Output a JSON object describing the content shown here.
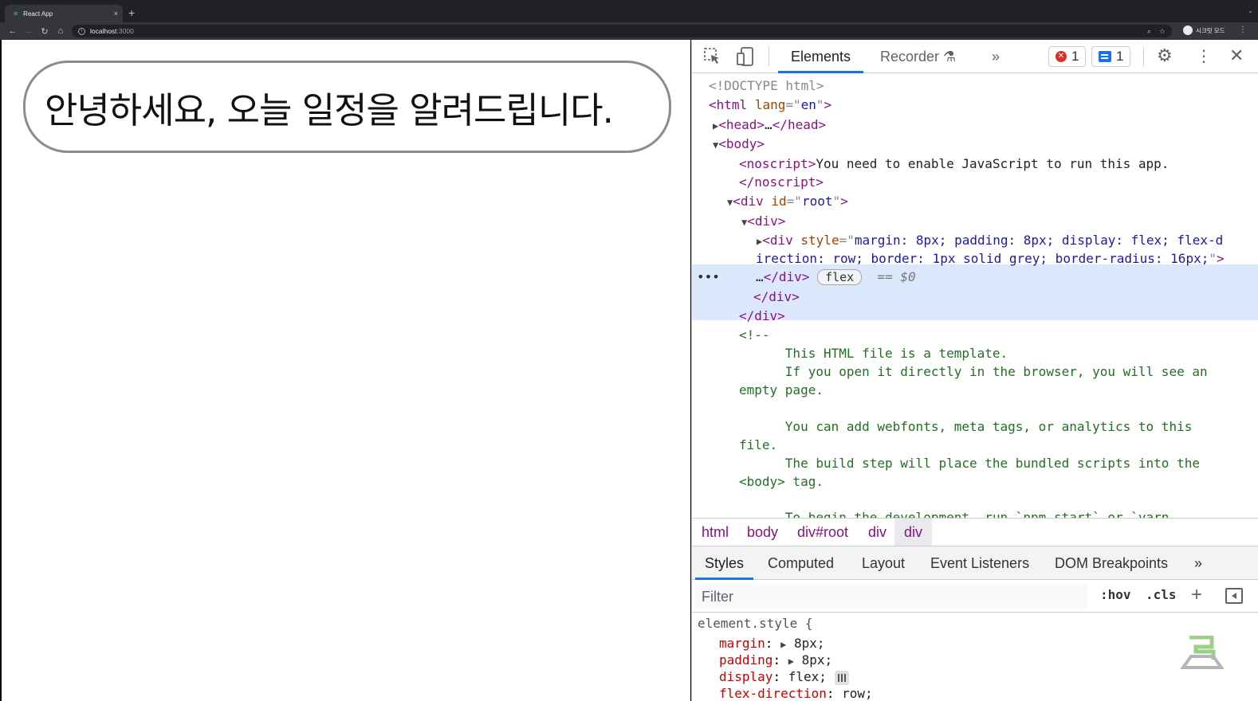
{
  "browser": {
    "tab_title": "React App",
    "tab_close": "×",
    "new_tab": "+",
    "address_host": "localhost",
    "address_port": ":3000",
    "profile_label": "시크릿 모드"
  },
  "page": {
    "greeting": "안녕하세요, 오늘 일정을 알려드립니다."
  },
  "devtools": {
    "tabs": {
      "elements": "Elements",
      "recorder": "Recorder"
    },
    "error_count": "1",
    "message_count": "1",
    "dom": {
      "doctype": "<!DOCTYPE html>",
      "html_tag": "html",
      "lang_attr": "lang",
      "lang_val": "en",
      "head_collapsed": "…",
      "body_tag": "body",
      "noscript_text": "You need to enable JavaScript to run this app.",
      "root_attr": "id",
      "root_val": "root",
      "selected_style_1": "margin: 8px; padding: 8px; display: flex; flex-d",
      "selected_style_2": "irection: row; border: 1px solid grey; border-radius: 16px;",
      "selected_tail": "…",
      "flex_badge": "flex",
      "eq_marker": "== $0",
      "comment_open": "<!--",
      "comment_lines": [
        "      This HTML file is a template.",
        "      If you open it directly in the browser, you will see an",
        "empty page.",
        "",
        "      You can add webfonts, meta tags, or analytics to this",
        "file.",
        "      The build step will place the bundled scripts into the",
        "<body> tag.",
        "",
        "      To begin the development, run `npm start` or `yarn"
      ]
    },
    "breadcrumbs": [
      "html",
      "body",
      "div#root",
      "div",
      "div"
    ],
    "style_tabs": [
      "Styles",
      "Computed",
      "Layout",
      "Event Listeners",
      "DOM Breakpoints"
    ],
    "filter_placeholder": "Filter",
    "hov": ":hov",
    "cls": ".cls",
    "styles": {
      "selector": "element.style {",
      "props": [
        {
          "name": "margin",
          "value": "8px;"
        },
        {
          "name": "padding",
          "value": "8px;"
        },
        {
          "name": "display",
          "value": "flex;"
        },
        {
          "name": "flex-direction",
          "value": "row;"
        }
      ]
    }
  }
}
